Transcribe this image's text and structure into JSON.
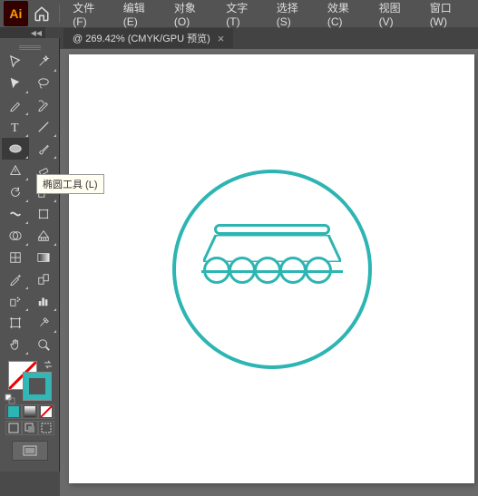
{
  "app": {
    "logo": "Ai"
  },
  "menu": {
    "file": "文件(F)",
    "edit": "编辑(E)",
    "object": "对象(O)",
    "type": "文字(T)",
    "select": "选择(S)",
    "effect": "效果(C)",
    "view": "视图(V)",
    "window": "窗口(W)"
  },
  "document": {
    "tab_label": "@ 269.42% (CMYK/GPU 预览)",
    "close": "×"
  },
  "tooltip": {
    "ellipse": "椭圆工具 (L)"
  },
  "panel": {
    "collapse": "◀◀"
  },
  "colors": {
    "artwork_stroke": "#2cb5b2",
    "stroke_swatch": "#32b7b7",
    "mode_fill": "#2cb5b5"
  }
}
